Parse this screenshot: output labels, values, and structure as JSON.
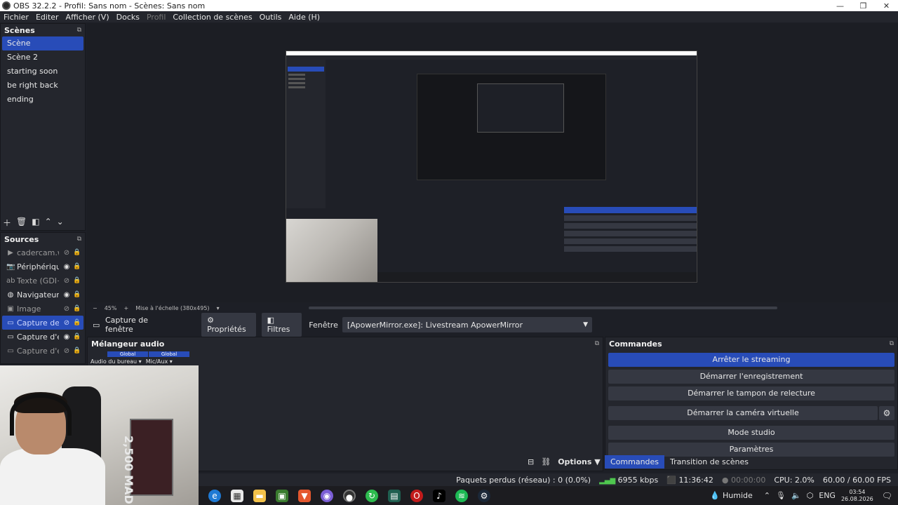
{
  "titlebar": {
    "title": "OBS 32.2.2 - Profil: Sans nom - Scènes: Sans nom",
    "min": "—",
    "max": "❐",
    "close": "✕"
  },
  "menu": [
    "Fichier",
    "Editer",
    "Afficher (V)",
    "Docks",
    "Profil",
    "Collection de scènes",
    "Outils",
    "Aide (H)"
  ],
  "scenes": {
    "title": "Scènes",
    "items": [
      "Scène",
      "Scène 2",
      "starting soon",
      "be right back",
      "ending"
    ],
    "active_index": 0
  },
  "sources": {
    "title": "Sources",
    "items": [
      {
        "icon": "play-icon",
        "glyph": "▶",
        "label": "cadercam.webr",
        "visible": false
      },
      {
        "icon": "camera-icon",
        "glyph": "📷",
        "label": "Périphérique de",
        "visible": true
      },
      {
        "icon": "text-icon",
        "glyph": "ab",
        "label": "Texte (GDI+)",
        "visible": false
      },
      {
        "icon": "globe-icon",
        "glyph": "◍",
        "label": "Navigateur web",
        "visible": true
      },
      {
        "icon": "image-icon",
        "glyph": "▣",
        "label": "Image",
        "visible": false
      },
      {
        "icon": "window-icon",
        "glyph": "▭",
        "label": "Capture de fenê",
        "visible": false
      },
      {
        "icon": "window-icon",
        "glyph": "▭",
        "label": "Capture d'écran",
        "visible": true
      },
      {
        "icon": "window-icon",
        "glyph": "▭",
        "label": "Capture d'écran",
        "visible": false
      }
    ],
    "active_index": 5
  },
  "preview": {
    "zoom": "45%",
    "scale_label": "Mise à l'échelle (380x495)"
  },
  "properties_bar": {
    "source_name": "Capture de fenêtre",
    "properties_label": "Propriétés",
    "filters_label": "Filtres",
    "window_label": "Fenêtre",
    "window_value": "[ApowerMirror.exe]: Livestream ApowerMirror"
  },
  "mixer": {
    "title": "Mélangeur audio",
    "global_labels": [
      "Global",
      "Global"
    ],
    "channels": [
      "Audio du bureau",
      "Mic/Aux"
    ],
    "options_label": "Options"
  },
  "commands": {
    "title": "Commandes",
    "buttons": [
      "Arrêter le streaming",
      "Démarrer l'enregistrement",
      "Démarrer le tampon de relecture",
      "Démarrer la caméra virtuelle",
      "Mode studio",
      "Paramètres"
    ],
    "tabs": [
      "Commandes",
      "Transition de scènes"
    ]
  },
  "status": {
    "dropped_frames": "Paquets perdus (réseau) : 0 (0.0%)",
    "bitrate": "6955 kbps",
    "stream_time": "11:36:42",
    "rec_time": "00:00:00",
    "cpu": "CPU: 2.0%",
    "fps": "60.00 / 60.00 FPS"
  },
  "webcam": {
    "box_text": "2,500 MAD"
  },
  "taskbar": {
    "weather": "Humide",
    "lang": "ENG",
    "time": "03:54",
    "date": "26.08.2026"
  }
}
